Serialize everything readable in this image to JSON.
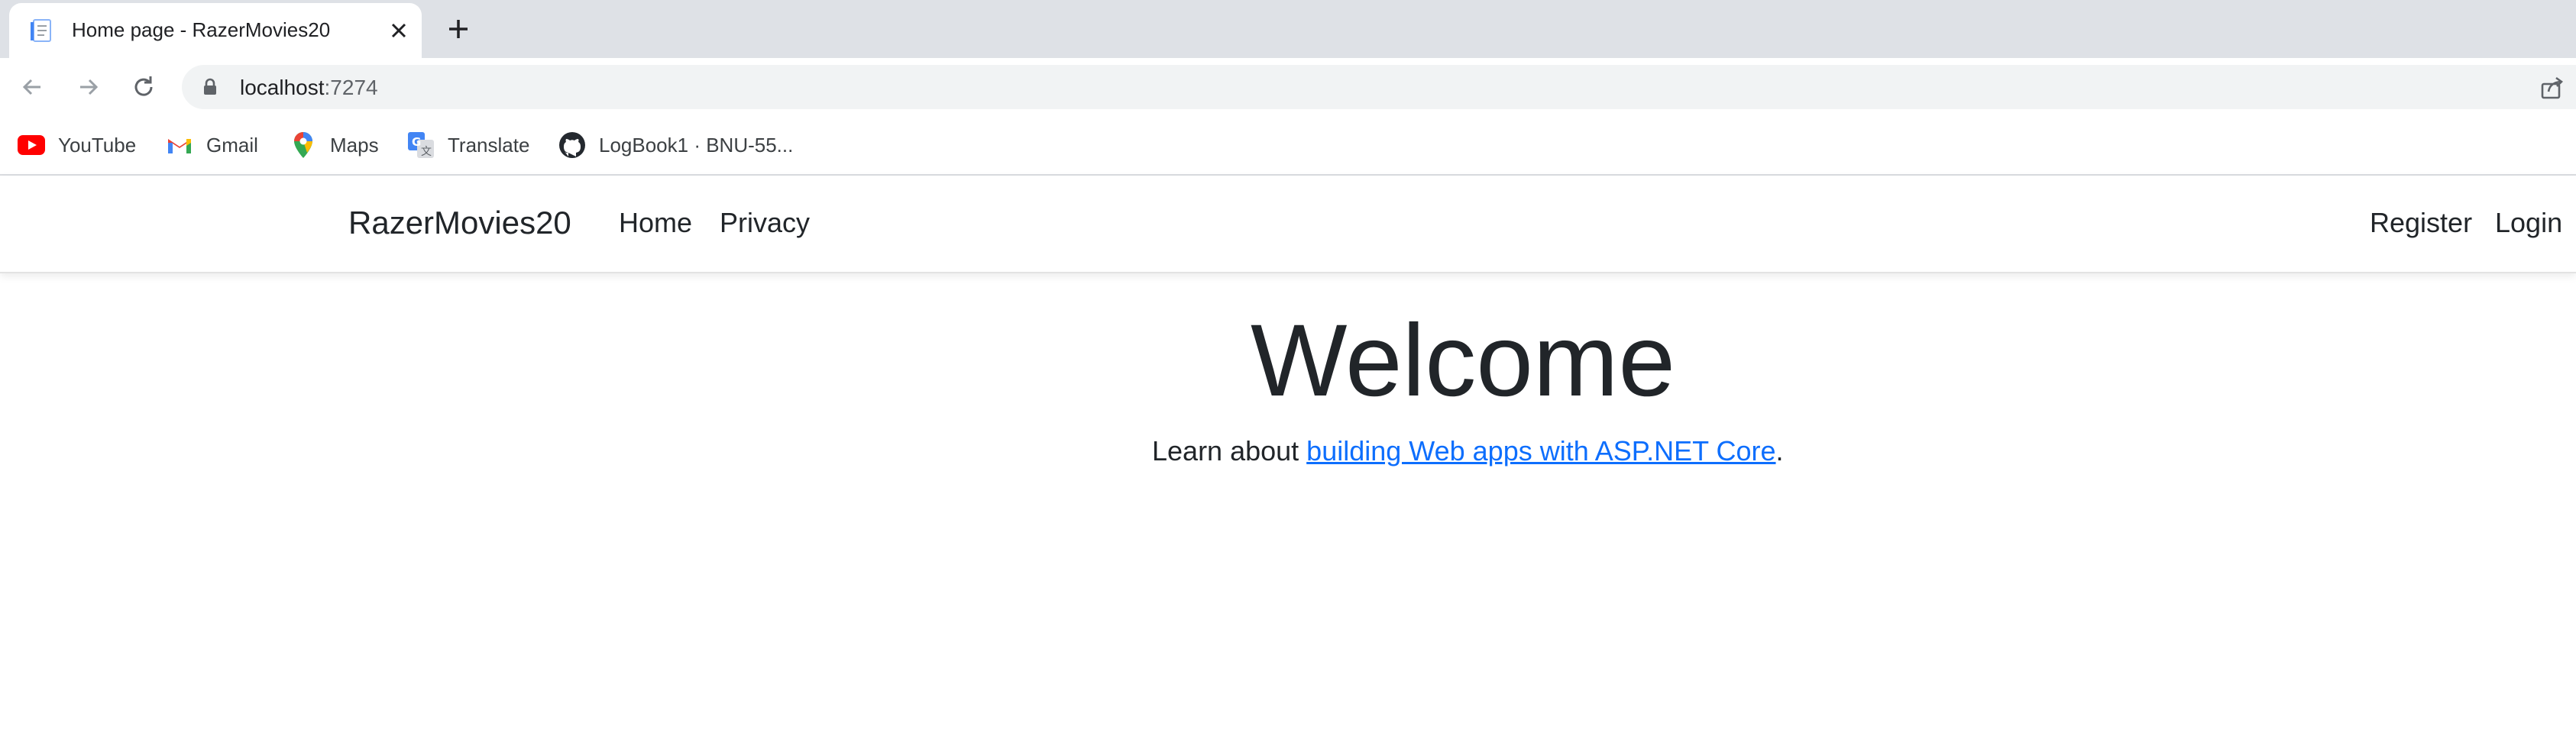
{
  "browser": {
    "tab": {
      "title": "Home page - RazerMovies20",
      "favicon": "document-icon"
    },
    "address": {
      "host": "localhost",
      "port": ":7274"
    },
    "bookmarks": [
      {
        "label": "YouTube",
        "icon": "youtube-icon"
      },
      {
        "label": "Gmail",
        "icon": "gmail-icon"
      },
      {
        "label": "Maps",
        "icon": "maps-icon"
      },
      {
        "label": "Translate",
        "icon": "translate-icon"
      },
      {
        "label": "LogBook1 · BNU-55...",
        "icon": "github-icon"
      }
    ]
  },
  "site": {
    "brand": "RazerMovies20",
    "nav": {
      "home": "Home",
      "privacy": "Privacy",
      "register": "Register",
      "login": "Login"
    }
  },
  "main": {
    "heading": "Welcome",
    "learn_prefix": "Learn about ",
    "learn_link": "building Web apps with ASP.NET Core",
    "learn_suffix": "."
  },
  "colors": {
    "link": "#0d6efd",
    "text": "#212529",
    "tabstrip": "#dee1e6"
  }
}
